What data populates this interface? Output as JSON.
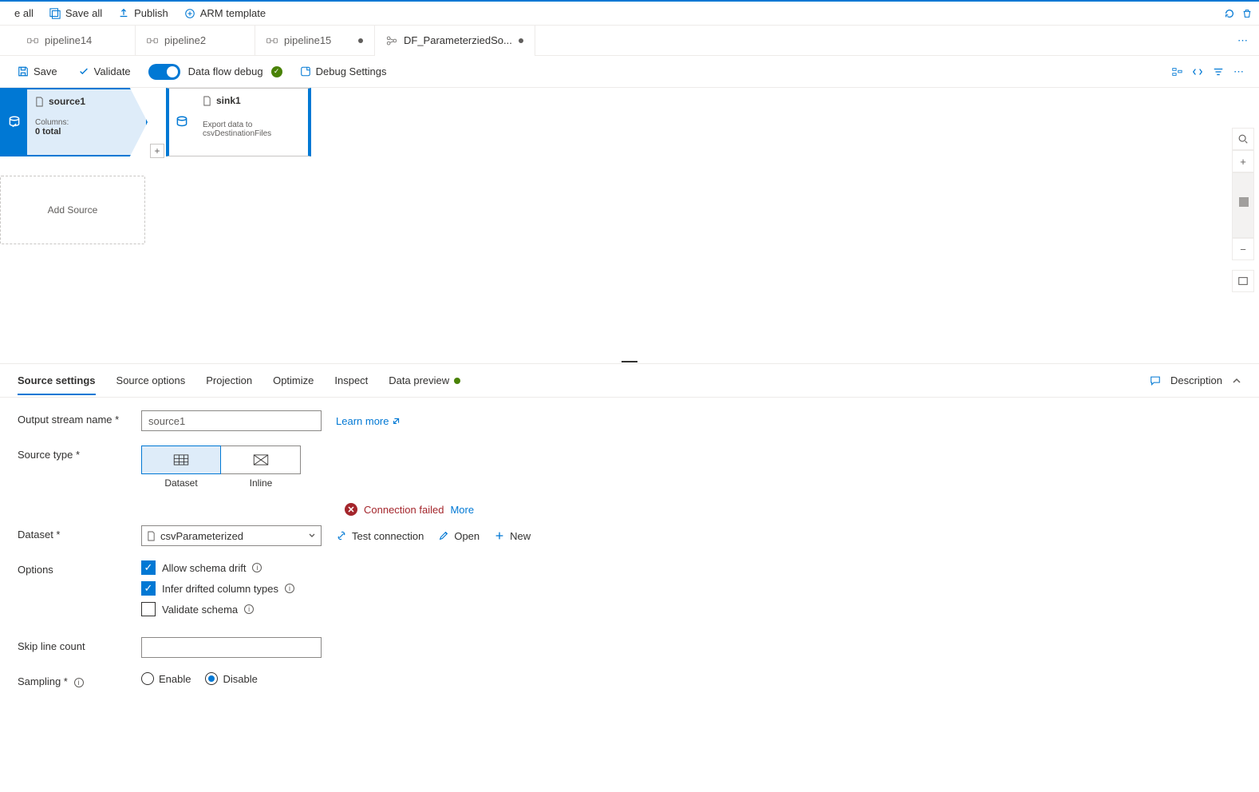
{
  "topbar": {
    "refresh_all": "e all",
    "save_all": "Save all",
    "publish": "Publish",
    "arm": "ARM template"
  },
  "tabs": [
    {
      "label": "pipeline14",
      "kind": "pipeline",
      "dirty": false
    },
    {
      "label": "pipeline2",
      "kind": "pipeline",
      "dirty": false
    },
    {
      "label": "pipeline15",
      "kind": "pipeline",
      "dirty": true
    },
    {
      "label": "DF_ParameterziedSo...",
      "kind": "dataflow",
      "dirty": true,
      "active": true
    }
  ],
  "toolbar": {
    "save": "Save",
    "validate": "Validate",
    "debug_label": "Data flow debug",
    "debug_settings": "Debug Settings"
  },
  "canvas": {
    "source": {
      "name": "source1",
      "columns_label": "Columns:",
      "columns_count": "0 total"
    },
    "sink": {
      "name": "sink1",
      "desc1": "Export data to",
      "desc2": "csvDestinationFiles"
    },
    "add_source": "Add Source"
  },
  "panel": {
    "tabs": {
      "source_settings": "Source settings",
      "source_options": "Source options",
      "projection": "Projection",
      "optimize": "Optimize",
      "inspect": "Inspect",
      "data_preview": "Data preview"
    },
    "description": "Description"
  },
  "form": {
    "output_stream_label": "Output stream name *",
    "output_stream_value": "source1",
    "learn_more": "Learn more",
    "source_type_label": "Source type *",
    "source_type_dataset": "Dataset",
    "source_type_inline": "Inline",
    "error_text": "Connection failed",
    "error_more": "More",
    "dataset_label": "Dataset *",
    "dataset_value": "csvParameterized",
    "test_connection": "Test connection",
    "open": "Open",
    "new": "New",
    "options_label": "Options",
    "allow_schema_drift": "Allow schema drift",
    "infer_drifted": "Infer drifted column types",
    "validate_schema": "Validate schema",
    "skip_line_label": "Skip line count",
    "skip_line_value": "",
    "sampling_label": "Sampling *",
    "enable": "Enable",
    "disable": "Disable"
  }
}
